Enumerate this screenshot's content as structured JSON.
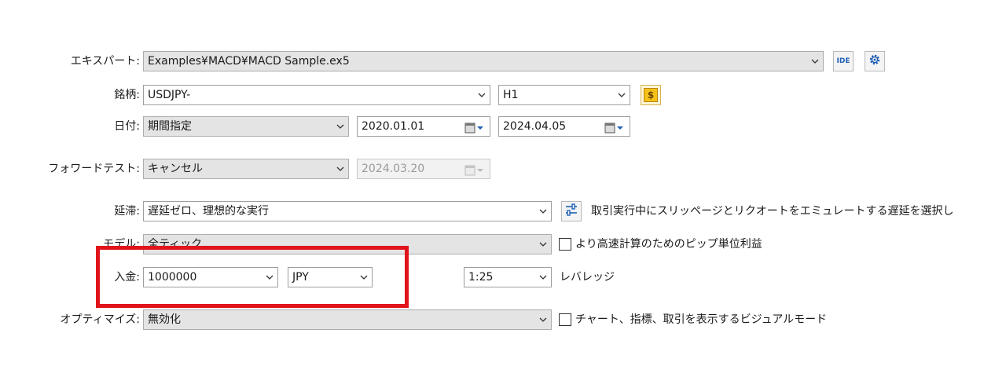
{
  "expert": {
    "label": "エキスパート:",
    "value": "Examples¥MACD¥MACD Sample.ex5",
    "ide_label": "IDE"
  },
  "symbol": {
    "label": "銘柄:",
    "value": "USDJPY-",
    "timeframe": "H1",
    "currency_icon": "$"
  },
  "date": {
    "label": "日付:",
    "mode": "期間指定",
    "from": "2020.01.01",
    "to": "2024.04.05"
  },
  "forward": {
    "label": "フォワードテスト:",
    "mode": "キャンセル",
    "date": "2024.03.20"
  },
  "delay": {
    "label": "延滞:",
    "value": "遅延ゼロ、理想的な実行",
    "description": "取引実行中にスリッページとリクオートをエミュレートする遅延を選択し"
  },
  "model": {
    "label": "モデル:",
    "value": "全ティック",
    "checkbox_label": "より高速計算のためのピップ単位利益",
    "checked": false
  },
  "deposit": {
    "label": "入金:",
    "amount": "1000000",
    "currency": "JPY",
    "leverage": "1:25",
    "leverage_label": "レバレッジ"
  },
  "optimization": {
    "label": "オプティマイズ:",
    "value": "無効化",
    "checkbox_label": "チャート、指標、取引を表示するビジュアルモード",
    "checked": false
  },
  "colors": {
    "highlight": "#e1141b",
    "field_gray": "#e4e4e4",
    "accent_blue": "#1f5fb4",
    "currency_yellow": "#f6c21a"
  }
}
